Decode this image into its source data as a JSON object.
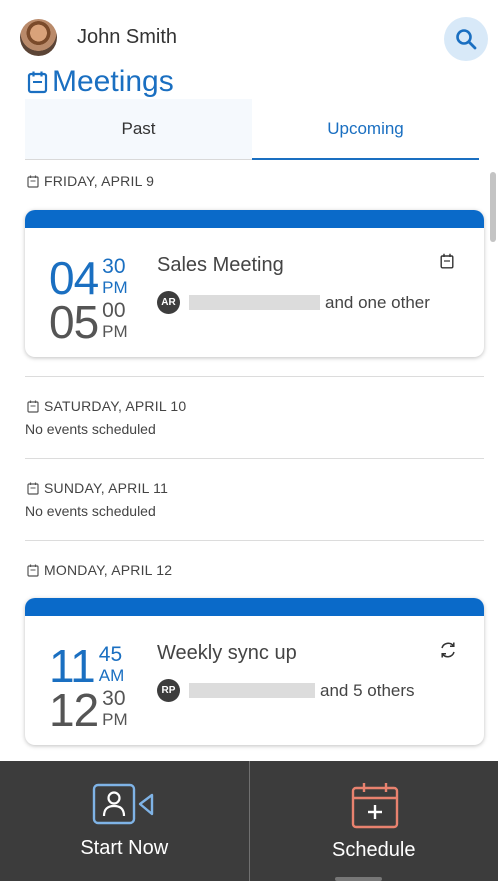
{
  "header": {
    "user_name": "John Smith"
  },
  "title": "Meetings",
  "tabs": {
    "past": "Past",
    "upcoming": "Upcoming"
  },
  "days": [
    {
      "label": "FRIDAY, APRIL 9"
    },
    {
      "label": "SATURDAY, APRIL 10",
      "empty": "No events scheduled"
    },
    {
      "label": "SUNDAY, APRIL 11",
      "empty": "No events scheduled"
    },
    {
      "label": "MONDAY, APRIL 12"
    }
  ],
  "meetings": [
    {
      "title": "Sales Meeting",
      "start": {
        "hour": "04",
        "min": "30",
        "mer": "PM"
      },
      "end": {
        "hour": "05",
        "min": "00",
        "mer": "PM"
      },
      "initials": "AR",
      "others": "and one other",
      "icon": "calendar-icon"
    },
    {
      "title": "Weekly sync up",
      "start": {
        "hour": "11",
        "min": "45",
        "mer": "AM"
      },
      "end": {
        "hour": "12",
        "min": "30",
        "mer": "PM"
      },
      "initials": "RP",
      "others": "and 5 others",
      "icon": "recurring-icon"
    }
  ],
  "bottom": {
    "start_now": "Start Now",
    "schedule": "Schedule"
  },
  "colors": {
    "accent": "#1a6fc1",
    "card_bar": "#0a6ac9",
    "bottom_bar": "#3c3c3c",
    "schedule_icon": "#e9826f",
    "start_icon": "#7fb3e6"
  }
}
